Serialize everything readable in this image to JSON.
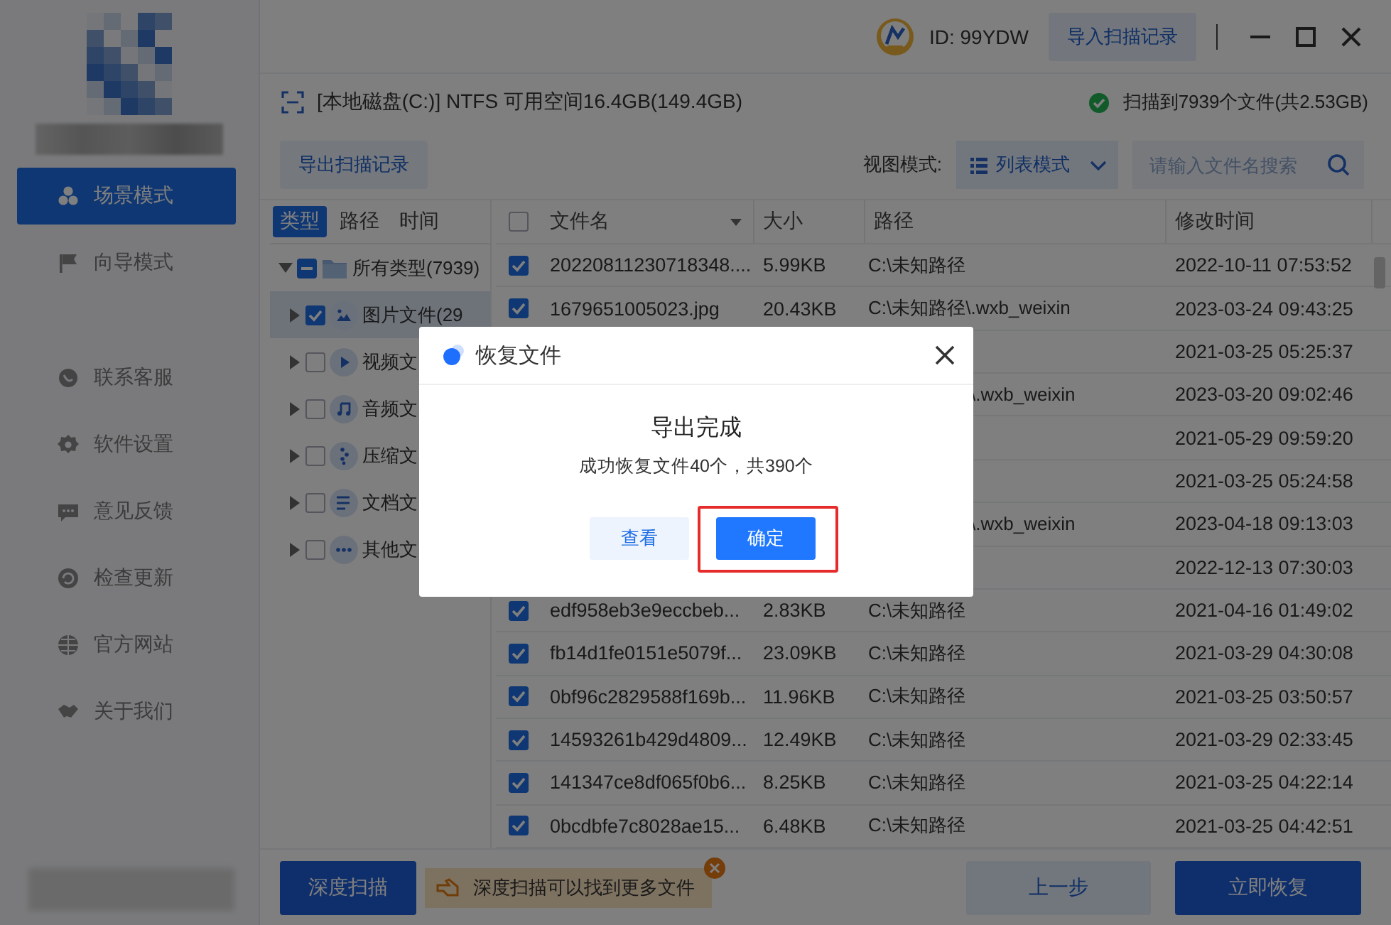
{
  "top_bar": {
    "account_id": "ID: 99YDW",
    "import_button": "导入扫描记录"
  },
  "sidebar": {
    "modes": [
      {
        "label": "场景模式",
        "selected": true
      },
      {
        "label": "向导模式",
        "selected": false
      }
    ],
    "links": [
      "联系客服",
      "软件设置",
      "意见反馈",
      "检查更新",
      "官方网站",
      "关于我们"
    ]
  },
  "drive_info": "[本地磁盘(C:)] NTFS 可用空间16.4GB(149.4GB)",
  "scan_result": "扫描到7939个文件(共2.53GB)",
  "toolbar": {
    "export_button": "导出扫描记录",
    "view_mode_label": "视图模式:",
    "view_mode": "列表模式",
    "search": {
      "placeholder": "请输入文件名搜索"
    }
  },
  "tree_panel": {
    "tabs": [
      {
        "label": "类型",
        "selected": true
      },
      {
        "label": "路径",
        "selected": false
      },
      {
        "label": "时间",
        "selected": false
      }
    ],
    "tree": [
      {
        "label": "所有类型(7939)",
        "checked": true,
        "indeterminate": true,
        "expanded": true,
        "selected": false,
        "children": [
          {
            "kind": "image",
            "label": "图片文件(29",
            "checked": true,
            "expanded": false,
            "selected": true
          },
          {
            "kind": "video",
            "label": "视频文",
            "checked": false,
            "expanded": false,
            "selected": false
          },
          {
            "kind": "audio",
            "label": "音频文",
            "checked": false,
            "expanded": false,
            "selected": false
          },
          {
            "kind": "archive",
            "label": "压缩文",
            "checked": false,
            "expanded": false,
            "selected": false
          },
          {
            "kind": "document",
            "label": "文档文",
            "checked": false,
            "expanded": false,
            "selected": false
          },
          {
            "kind": "other",
            "label": "其他文",
            "checked": false,
            "expanded": false,
            "selected": false
          }
        ]
      }
    ]
  },
  "table": {
    "header_checked": false,
    "columns": [
      "文件名",
      "大小",
      "路径",
      "修改时间"
    ],
    "rows": [
      {
        "checked": true,
        "name": "20220811230718348....",
        "size": "5.99KB",
        "path": "C:\\未知路径",
        "modified": "2022-10-11 07:53:52"
      },
      {
        "checked": true,
        "name": "1679651005023.jpg",
        "size": "20.43KB",
        "path": "C:\\未知路径\\.wxb_weixin",
        "modified": "2023-03-24 09:43:25"
      },
      {
        "modified": "2021-03-25 05:25:37"
      },
      {
        "path_tail": "\\.wxb_weixin",
        "modified": "2023-03-20 09:02:46"
      },
      {
        "modified": "2021-05-29 09:59:20"
      },
      {
        "modified": "2021-03-25 05:24:58"
      },
      {
        "path_tail": "\\.wxb_weixin",
        "modified": "2023-04-18 09:13:03"
      },
      {
        "modified": "2022-12-13 07:30:03"
      },
      {
        "checked": true,
        "name": "edf958eb3e9eccbeb...",
        "size": "2.83KB",
        "path": "C:\\未知路径",
        "modified": "2021-04-16 01:49:02"
      },
      {
        "checked": true,
        "name": "fb14d1fe0151e5079f...",
        "size": "23.09KB",
        "path": "C:\\未知路径",
        "modified": "2021-03-29 04:30:08"
      },
      {
        "checked": true,
        "name": "0bf96c2829588f169b...",
        "size": "11.96KB",
        "path": "C:\\未知路径",
        "modified": "2021-03-25 03:50:57"
      },
      {
        "checked": true,
        "name": "14593261b429d4809...",
        "size": "12.49KB",
        "path": "C:\\未知路径",
        "modified": "2021-03-29 02:33:45"
      },
      {
        "checked": true,
        "name": "141347ce8df065f0b6...",
        "size": "8.25KB",
        "path": "C:\\未知路径",
        "modified": "2021-03-25 04:22:14"
      },
      {
        "checked": true,
        "name": "0bcdbfe7c8028ae15...",
        "size": "6.48KB",
        "path": "C:\\未知路径",
        "modified": "2021-03-25 04:42:51"
      }
    ]
  },
  "bottom_bar": {
    "deep_scan_button": "深度扫描",
    "tip": "深度扫描可以找到更多文件",
    "back_button": "上一步",
    "recover_button": "立即恢复"
  },
  "dialog": {
    "title": "恢复文件",
    "heading": "导出完成",
    "message": "成功恢复文件40个，共390个",
    "buttons": [
      {
        "label": "查看",
        "kind": "secondary",
        "highlighted": false
      },
      {
        "label": "确定",
        "kind": "primary",
        "highlighted": true
      }
    ]
  }
}
